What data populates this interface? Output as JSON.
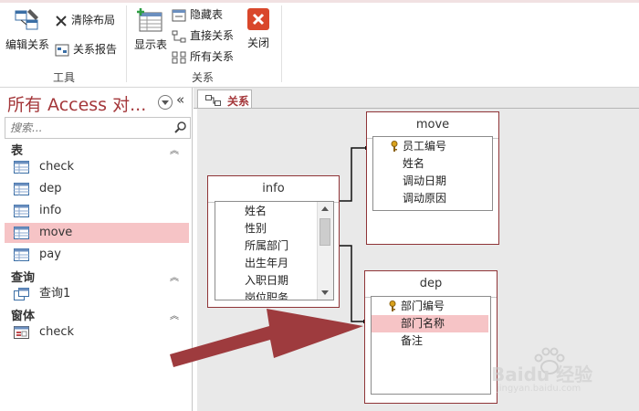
{
  "ribbon": {
    "tools": {
      "edit_relationships": "编辑关系",
      "clear_layout": "清除布局",
      "relationship_report": "关系报告",
      "group_label": "工具"
    },
    "relationships": {
      "show_table": "显示表",
      "hide_table": "隐藏表",
      "direct_relationships": "直接关系",
      "all_relationships": "所有关系",
      "close": "关闭",
      "group_label": "关系"
    }
  },
  "nav": {
    "title": "所有 Access 对...",
    "search_placeholder": "搜索...",
    "sections": [
      {
        "label": "表",
        "items": [
          "check",
          "dep",
          "info",
          "move",
          "pay"
        ],
        "selected": "move"
      },
      {
        "label": "查询",
        "items": [
          "查询1"
        ]
      },
      {
        "label": "窗体",
        "items": [
          "check"
        ]
      }
    ]
  },
  "document": {
    "tab_label": "关系",
    "tables": {
      "move": {
        "title": "move",
        "fields": [
          "员工编号",
          "姓名",
          "调动日期",
          "调动原因"
        ],
        "key_field": "员工编号"
      },
      "info": {
        "title": "info",
        "fields": [
          "姓名",
          "性别",
          "所属部门",
          "出生年月",
          "入职日期",
          "岗位职务"
        ]
      },
      "dep": {
        "title": "dep",
        "fields": [
          "部门编号",
          "部门名称",
          "备注"
        ],
        "key_field": "部门编号",
        "selected_field": "部门名称"
      }
    }
  },
  "watermark": {
    "brand": "Baidu 经验",
    "url": "jingyan.baidu.com"
  },
  "colors": {
    "accent": "#a4373a",
    "selection": "#f6c4c6",
    "arrow": "#9e3b3e",
    "close_button": "#d9472b"
  }
}
